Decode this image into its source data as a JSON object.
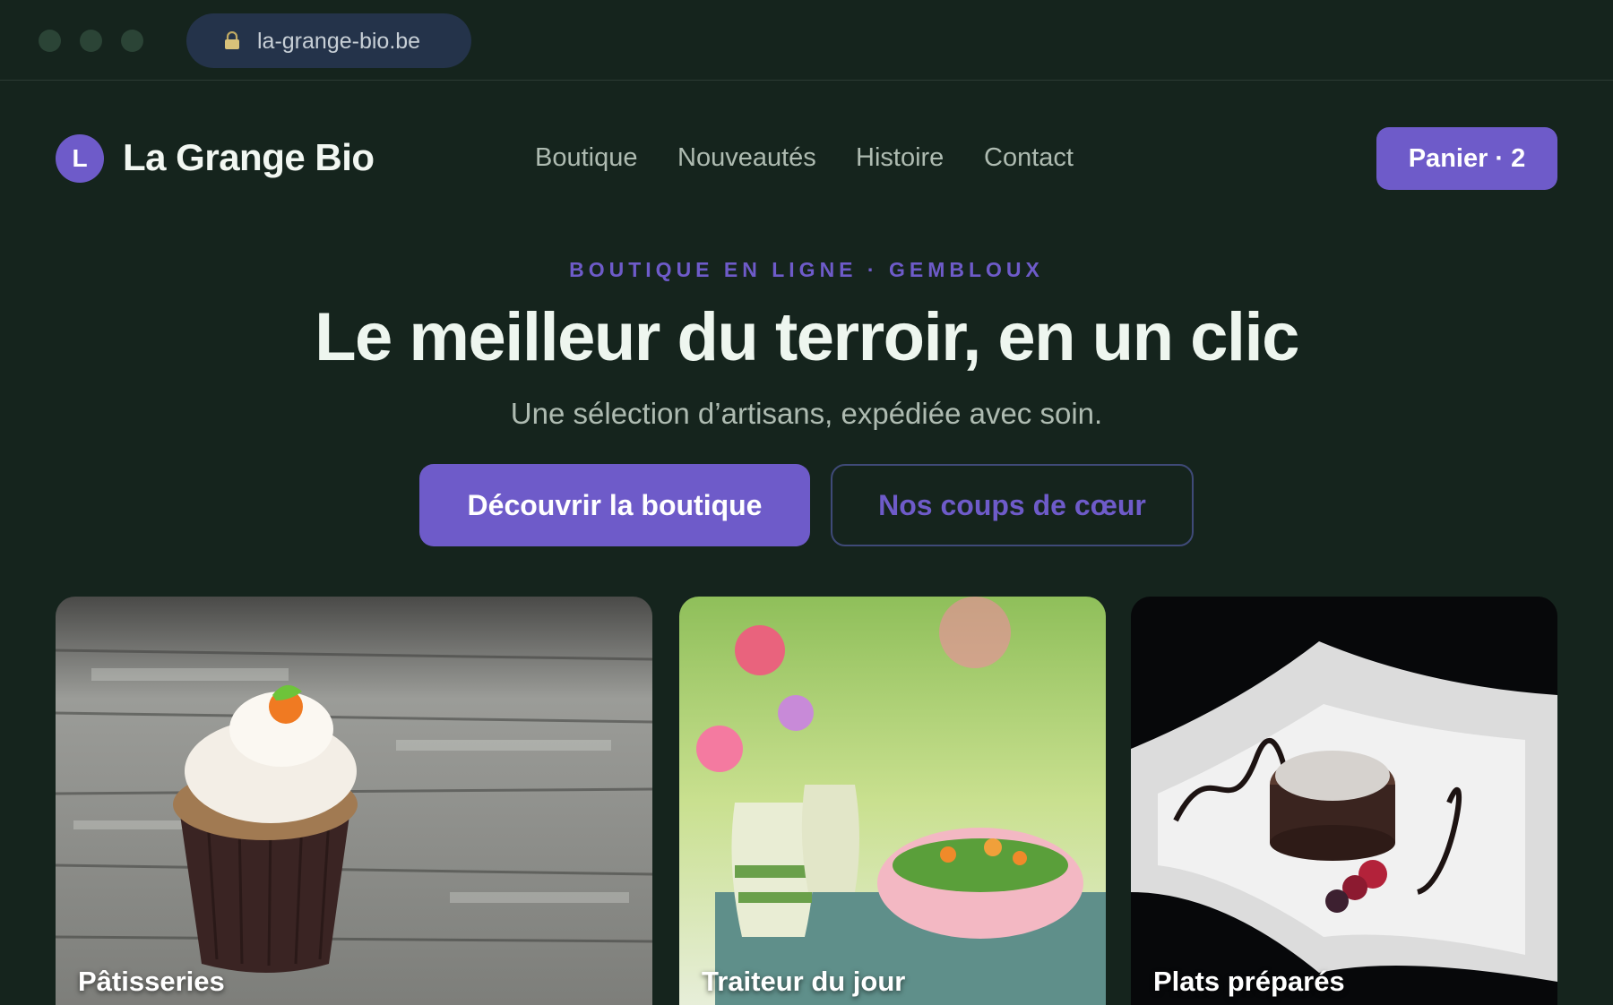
{
  "browser": {
    "url": "la-grange-bio.be"
  },
  "brand": {
    "initial": "L",
    "name": "La Grange Bio"
  },
  "nav": {
    "items": [
      "Boutique",
      "Nouveautés",
      "Histoire",
      "Contact"
    ],
    "cart_label": "Panier · 2"
  },
  "hero": {
    "eyebrow": "BOUTIQUE EN LIGNE · GEMBLOUX",
    "title": "Le meilleur du terroir, en un clic",
    "subtitle": "Une sélection d’artisans, expédiée avec soin.",
    "primary_cta": "Découvrir la boutique",
    "secondary_cta": "Nos coups de cœur"
  },
  "categories": [
    {
      "label": "Pâtisseries",
      "image": "cupcake on weathered wooden table"
    },
    {
      "label": "Traiteur du jour",
      "image": "salad bowl with oil cruets and flowers"
    },
    {
      "label": "Plats préparés",
      "image": "chocolate lava cake with berries on white plate"
    }
  ],
  "colors": {
    "background": "#15241d",
    "accent": "#6e5bc9",
    "text": "#eef6ef",
    "muted": "#aebbb1"
  }
}
